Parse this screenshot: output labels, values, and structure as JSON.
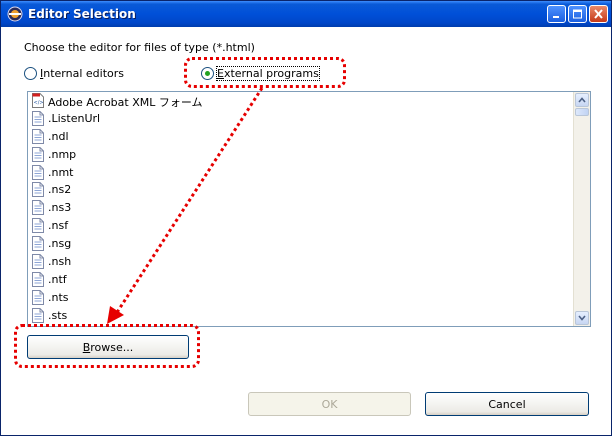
{
  "window": {
    "title": "Editor Selection",
    "icon": "eclipse-icon",
    "controls": [
      "minimize-icon",
      "maximize-icon",
      "close-icon"
    ]
  },
  "prompt": "Choose the editor for files of type (*.html)",
  "radios": {
    "internal": {
      "label": "Internal editors",
      "selected": false
    },
    "external": {
      "label": "External programs",
      "selected": true
    }
  },
  "file_list": {
    "items": [
      {
        "label": "Adobe Acrobat XML フォーム",
        "icon": "pdf-xml-icon"
      },
      {
        "label": ".ListenUrl",
        "icon": "document-icon"
      },
      {
        "label": ".ndl",
        "icon": "document-icon"
      },
      {
        "label": ".nmp",
        "icon": "document-icon"
      },
      {
        "label": ".nmt",
        "icon": "document-icon"
      },
      {
        "label": ".ns2",
        "icon": "document-icon"
      },
      {
        "label": ".ns3",
        "icon": "document-icon"
      },
      {
        "label": ".nsf",
        "icon": "document-icon"
      },
      {
        "label": ".nsg",
        "icon": "document-icon"
      },
      {
        "label": ".nsh",
        "icon": "document-icon"
      },
      {
        "label": ".ntf",
        "icon": "document-icon"
      },
      {
        "label": ".nts",
        "icon": "document-icon"
      },
      {
        "label": ".sts",
        "icon": "document-icon"
      }
    ]
  },
  "buttons": {
    "browse": "Browse...",
    "ok": "OK",
    "cancel": "Cancel"
  },
  "annotation_color": "#e60000"
}
